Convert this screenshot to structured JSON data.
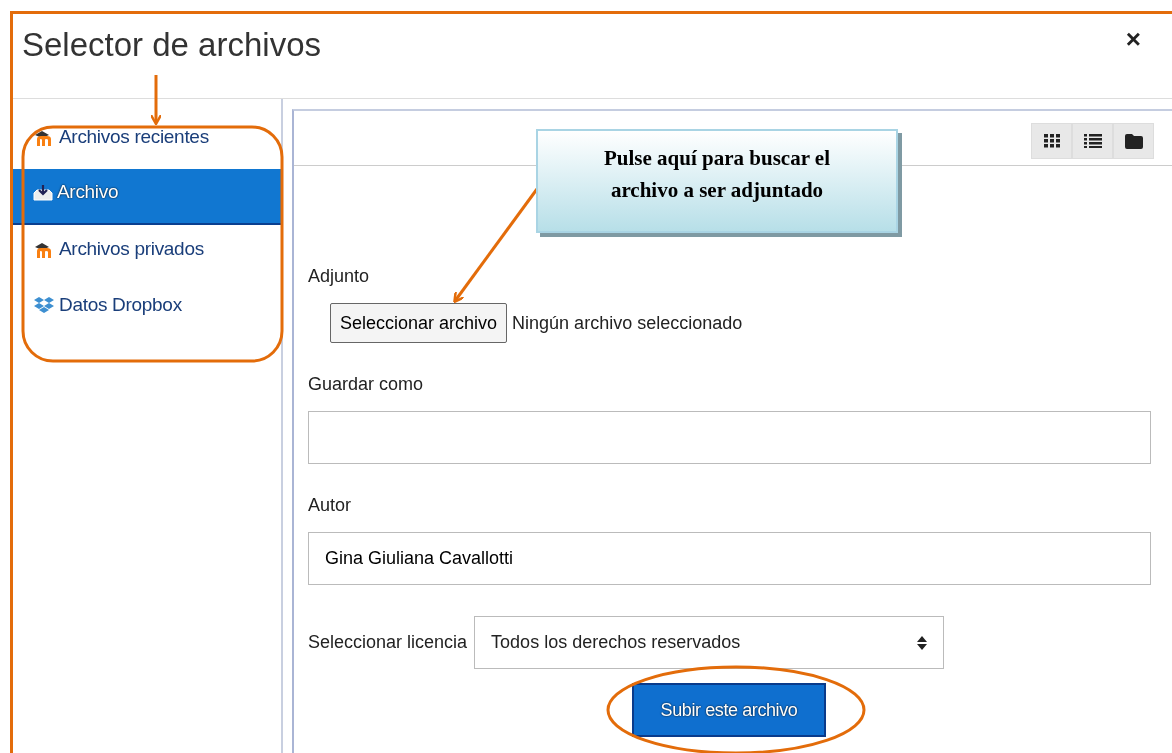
{
  "window": {
    "title": "Selector de archivos",
    "close": "×"
  },
  "sidebar": {
    "items": [
      {
        "label": "Archivos recientes",
        "kind": "moodle",
        "selected": false
      },
      {
        "label": "Archivo",
        "kind": "upload",
        "selected": true
      },
      {
        "label": "Archivos privados",
        "kind": "moodle",
        "selected": false
      },
      {
        "label": "Datos Dropbox",
        "kind": "dropbox",
        "selected": false
      }
    ]
  },
  "toolbar": {
    "views": [
      {
        "kind": "grid"
      },
      {
        "kind": "list"
      },
      {
        "kind": "folder"
      }
    ]
  },
  "callout": {
    "text": "Pulse aquí para buscar el archivo a ser adjuntado"
  },
  "form": {
    "attachment": {
      "label": "Adjunto",
      "button": "Seleccionar archivo",
      "status": "Ningún archivo seleccionado"
    },
    "save_as": {
      "label": "Guardar como"
    },
    "author": {
      "label": "Autor",
      "value": "Gina Giuliana Cavallotti"
    },
    "license": {
      "label": "Seleccionar licencia",
      "value": "Todos los derechos reservados"
    },
    "submit": "Subir este archivo"
  }
}
